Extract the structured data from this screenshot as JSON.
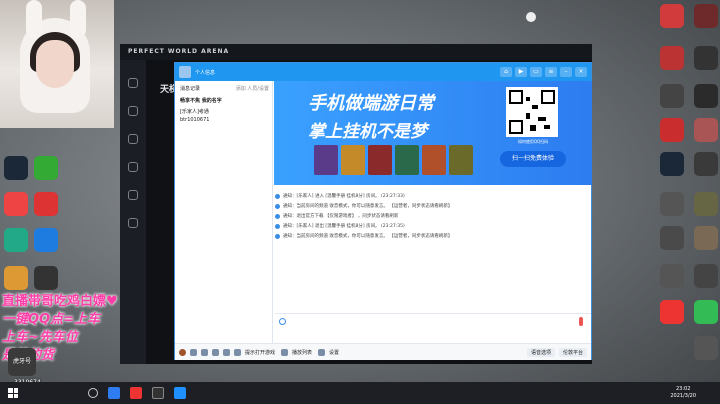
{
  "launcher": {
    "brand": "PERFECT WORLD ARENA",
    "page_title": "天梯"
  },
  "qq": {
    "title": "个人信息",
    "left_header": "消息记录",
    "left_header_right": "添加 人员/设置",
    "left_sub": "畅享不焦  我的名字",
    "left_rows": [
      "[乐家人]考通",
      "btr1010671"
    ],
    "banner": {
      "line1": "手机做端游日常",
      "line2": "掌上挂机不是梦",
      "qr_caption": "如何使用QQ扫码",
      "scan_button": "扫一扫免费体验"
    },
    "messages": [
      "通知：[乐家人] 进入 [温馨手册 挂机8分] 房间。 (23:27:33)",
      "通知：当前房间的频道 收音模式，你可以随意发言。 【运营者，同步状态请看刷新】",
      "通知：退出官方下载 【仅限游戏者】 ，同步状态请看刷新",
      "通知：[乐家人] 退出 [温馨手册 挂机8分] 房间。 (23:27:35)",
      "通知：当前房间的频道 收音模式，你可以随意发言。 【运营者，同步状态请看刷新】"
    ],
    "bottombar": {
      "item_a": "提示打开游戏",
      "item_b": "播放列表",
      "item_c": "设置",
      "right_a": "语音选项",
      "right_b": "伦敦平台"
    }
  },
  "overlay": {
    "line1": "直播带哥吃鸡白嫖♥",
    "line2": "一键QQ点=上车",
    "line3": "上车~先车位",
    "line4": "是的的货"
  },
  "logo_text": "虎牙号",
  "room_id": "3310674",
  "clock": {
    "time": "23:02",
    "date": "2021/3/20"
  }
}
